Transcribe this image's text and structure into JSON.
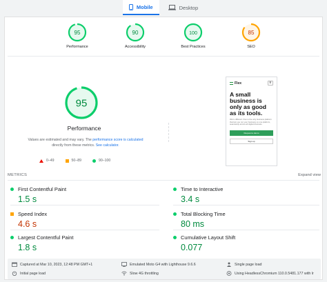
{
  "tabs": [
    {
      "label": "Mobile",
      "active": true,
      "icon": "phone-icon"
    },
    {
      "label": "Desktop",
      "active": false,
      "icon": "laptop-icon"
    }
  ],
  "summary": [
    {
      "score": "95",
      "label": "Performance",
      "color": "#0cce6b"
    },
    {
      "score": "90",
      "label": "Accessibility",
      "color": "#0cce6b"
    },
    {
      "score": "100",
      "label": "Best Practices",
      "color": "#0cce6b"
    },
    {
      "score": "85",
      "label": "SEO",
      "color": "#ffa400"
    }
  ],
  "performance": {
    "score": "95",
    "title": "Performance",
    "note_a": "Values are estimated and may vary. The ",
    "note_link1": "performance score is calculated",
    "note_b": " directly from these metrics. ",
    "note_link2": "See calculator.",
    "legend": [
      "0–49",
      "50–89",
      "90–100"
    ]
  },
  "screenshot": {
    "brand": "Flex",
    "menu_glyph": "≡",
    "headline": "A small business is only as good as its tools.",
    "subtext": "We're different. Flex is the only business platform that lets you run your business on one platform, seamlessly across all digital channels.",
    "primary_button": "Request a demo",
    "secondary_button": "Sign up"
  },
  "metrics": {
    "header": "METRICS",
    "expand_label": "Expand view",
    "items": [
      {
        "name": "First Contentful Paint",
        "value": "1.5 s",
        "status": "good"
      },
      {
        "name": "Time to Interactive",
        "value": "3.4 s",
        "status": "good"
      },
      {
        "name": "Speed Index",
        "value": "4.6 s",
        "status": "average"
      },
      {
        "name": "Total Blocking Time",
        "value": "80 ms",
        "status": "good"
      },
      {
        "name": "Largest Contentful Paint",
        "value": "1.8 s",
        "status": "good"
      },
      {
        "name": "Cumulative Layout Shift",
        "value": "0.077",
        "status": "good"
      }
    ]
  },
  "footer": {
    "captured": "Captured at Mar 10, 2023, 12:48 PM GMT+1",
    "emulated": "Emulated Moto G4 with Lighthouse 9.6.6",
    "single_load": "Single page load",
    "initial_load": "Initial page load",
    "throttling": "Slow 4G throttling",
    "browser": "Using HeadlessChromium 110.0.5481.177 with lr"
  },
  "colors": {
    "good": "#0cce6b",
    "average": "#ffa400",
    "poor": "#eb0f00",
    "accent": "#1a73e8"
  }
}
